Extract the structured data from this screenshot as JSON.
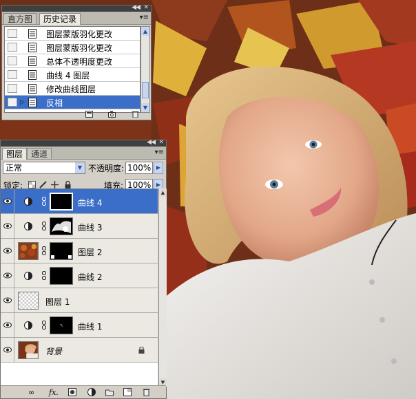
{
  "history_panel": {
    "tabs": [
      {
        "label": "直方图",
        "active": false
      },
      {
        "label": "历史记录",
        "active": true
      }
    ],
    "items": [
      {
        "label": "图层蒙版羽化更改",
        "selected": false
      },
      {
        "label": "图层蒙版羽化更改",
        "selected": false
      },
      {
        "label": "总体不透明度更改",
        "selected": false
      },
      {
        "label": "曲线 4 图层",
        "selected": false
      },
      {
        "label": "修改曲线图层",
        "selected": false
      },
      {
        "label": "反相",
        "selected": true
      }
    ],
    "footer_icons": [
      "new-document-from-state-icon",
      "snapshot-camera-icon",
      "trash-icon"
    ]
  },
  "layers_panel": {
    "tabs": [
      {
        "label": "图层",
        "active": true
      },
      {
        "label": "通道",
        "active": false
      }
    ],
    "blend_mode": "正常",
    "opacity_label": "不透明度:",
    "opacity_value": "100%",
    "lock_label": "锁定:",
    "fill_label": "填充:",
    "fill_value": "100%",
    "layers": [
      {
        "name": "曲线 4",
        "kind": "adjustment",
        "selected": true,
        "italic": false
      },
      {
        "name": "曲线 3",
        "kind": "adjustment",
        "selected": false,
        "italic": false
      },
      {
        "name": "图层 2",
        "kind": "pixel-with-mask",
        "selected": false,
        "italic": false
      },
      {
        "name": "曲线 2",
        "kind": "adjustment",
        "selected": false,
        "italic": false
      },
      {
        "name": "图层 1",
        "kind": "transparent",
        "selected": false,
        "italic": false
      },
      {
        "name": "曲线 1",
        "kind": "adjustment",
        "selected": false,
        "italic": false
      },
      {
        "name": "背景",
        "kind": "background",
        "selected": false,
        "italic": true
      }
    ],
    "footer_icons": [
      "link-layers-icon",
      "fx-icon",
      "add-mask-icon",
      "adjustment-layer-icon",
      "new-group-icon",
      "new-layer-icon",
      "trash-icon"
    ]
  },
  "colors": {
    "selection": "#3a6ec8",
    "panel_bg": "#d4d0c8",
    "titlebar": "#3f3f3f"
  }
}
